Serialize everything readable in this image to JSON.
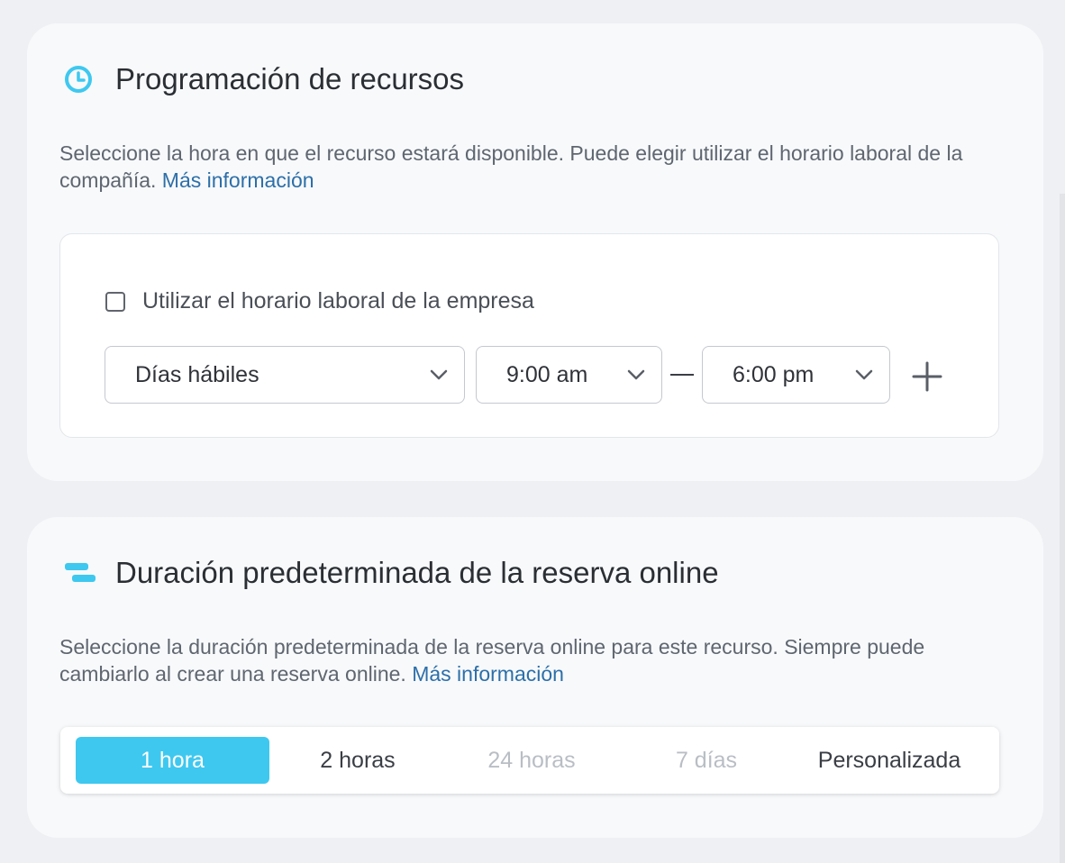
{
  "colors": {
    "accent": "#3ec8f0",
    "link": "#2d6fa8"
  },
  "schedule": {
    "icon": "clock-icon",
    "title": "Programación de recursos",
    "description": "Seleccione la hora en que el recurso estará disponible. Puede elegir utilizar el horario laboral de la compañía.",
    "more_info": "Más información",
    "use_company_hours": {
      "label": "Utilizar el horario laboral de la empresa",
      "checked": false
    },
    "days_select": "Días hábiles",
    "start_time": "9:00 am",
    "end_time": "6:00 pm",
    "add_icon": "plus-icon"
  },
  "duration": {
    "icon": "duration-bars-icon",
    "title": "Duración predeterminada de la reserva online",
    "description": "Seleccione la duración predeterminada de la reserva online para este recurso. Siempre puede cambiarlo al crear una reserva online.",
    "more_info": "Más información",
    "options": [
      {
        "label": "1 hora",
        "state": "selected"
      },
      {
        "label": "2 horas",
        "state": "enabled"
      },
      {
        "label": "24 horas",
        "state": "disabled"
      },
      {
        "label": "7 días",
        "state": "disabled"
      },
      {
        "label": "Personalizada",
        "state": "enabled"
      }
    ]
  }
}
